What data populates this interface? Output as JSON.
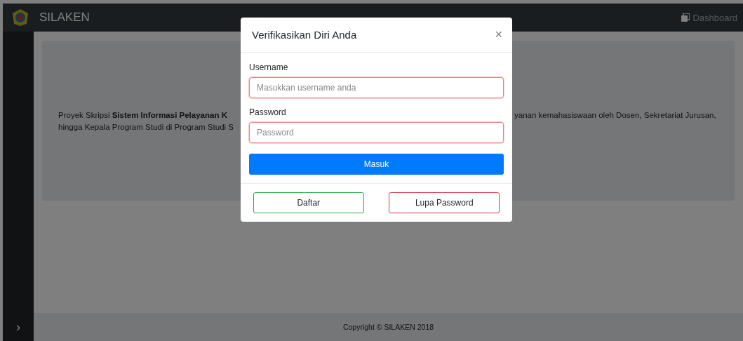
{
  "navbar": {
    "brand": "SILAKEN",
    "link": "Dashboard"
  },
  "intro": {
    "line1_left": "Proyek Skripsi **Sistem Informasi Pelayanan K**",
    "line1_right": "yanan kemahasiswaan oleh Dosen, Sekretariat Jurusan,",
    "line2_left": "hingga Kepala Program Studi di Program Studi S"
  },
  "sidebar": {
    "toggle": "›"
  },
  "footer": "Copyright © SILAKEN 2018",
  "modal": {
    "title": "Verifikasikan Diri Anda",
    "close": "×",
    "fields": [
      {
        "label": "Username",
        "placeholder": "Masukkan username anda",
        "invalid": true
      },
      {
        "label": "Password",
        "placeholder": "Password",
        "invalid": true
      }
    ],
    "submit": "Masuk",
    "buttons": [
      {
        "label": "Daftar",
        "color": "#28a745"
      },
      {
        "label": "Lupa Password",
        "color": "#dc3545"
      }
    ]
  }
}
